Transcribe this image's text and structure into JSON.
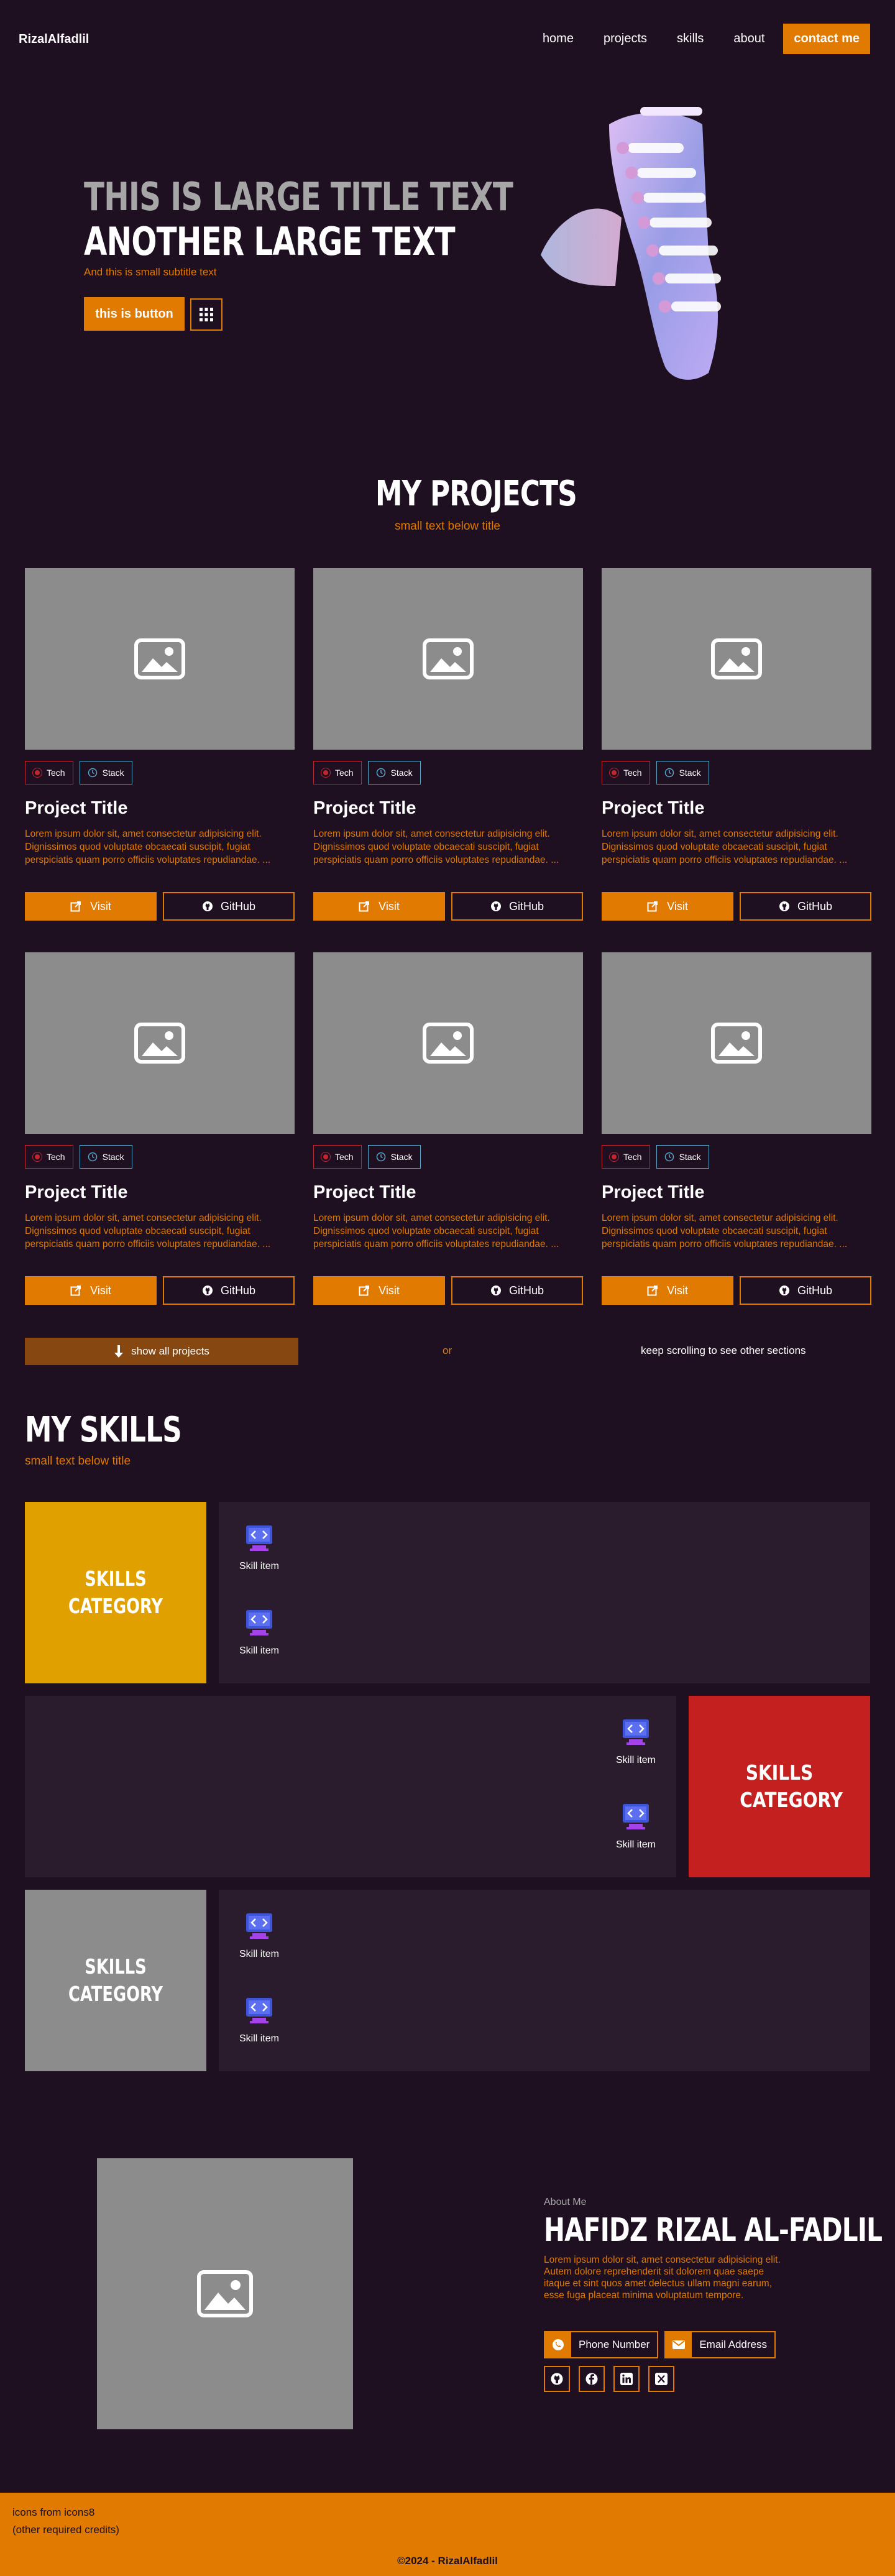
{
  "nav": {
    "brand": "RizalAlfadlil",
    "links": [
      "home",
      "projects",
      "skills",
      "about"
    ],
    "cta": "contact me"
  },
  "hero": {
    "title_1": "THIS IS LARGE TITLE TEXT",
    "title_2": "ANOTHER LARGE TEXT",
    "subtitle": "And this is small subtitle text",
    "button": "this is button"
  },
  "projects": {
    "title": "MY PROJECTS",
    "subtitle": "small text below title",
    "cards": [
      {
        "tag_tech": "Tech",
        "tag_stack": "Stack",
        "title": "Project Title",
        "desc": "Lorem ipsum dolor sit, amet consectetur adipisicing elit. Dignissimos quod voluptate obcaecati suscipit, fugiat perspiciatis quam porro officiis voluptates repudiandae. ...",
        "visit": "Visit",
        "github": "GitHub"
      },
      {
        "tag_tech": "Tech",
        "tag_stack": "Stack",
        "title": "Project Title",
        "desc": "Lorem ipsum dolor sit, amet consectetur adipisicing elit. Dignissimos quod voluptate obcaecati suscipit, fugiat perspiciatis quam porro officiis voluptates repudiandae. ...",
        "visit": "Visit",
        "github": "GitHub"
      },
      {
        "tag_tech": "Tech",
        "tag_stack": "Stack",
        "title": "Project Title",
        "desc": "Lorem ipsum dolor sit, amet consectetur adipisicing elit. Dignissimos quod voluptate obcaecati suscipit, fugiat perspiciatis quam porro officiis voluptates repudiandae. ...",
        "visit": "Visit",
        "github": "GitHub"
      },
      {
        "tag_tech": "Tech",
        "tag_stack": "Stack",
        "title": "Project Title",
        "desc": "Lorem ipsum dolor sit, amet consectetur adipisicing elit. Dignissimos quod voluptate obcaecati suscipit, fugiat perspiciatis quam porro officiis voluptates repudiandae. ...",
        "visit": "Visit",
        "github": "GitHub"
      },
      {
        "tag_tech": "Tech",
        "tag_stack": "Stack",
        "title": "Project Title",
        "desc": "Lorem ipsum dolor sit, amet consectetur adipisicing elit. Dignissimos quod voluptate obcaecati suscipit, fugiat perspiciatis quam porro officiis voluptates repudiandae. ...",
        "visit": "Visit",
        "github": "GitHub"
      },
      {
        "tag_tech": "Tech",
        "tag_stack": "Stack",
        "title": "Project Title",
        "desc": "Lorem ipsum dolor sit, amet consectetur adipisicing elit. Dignissimos quod voluptate obcaecati suscipit, fugiat perspiciatis quam porro officiis voluptates repudiandae. ...",
        "visit": "Visit",
        "github": "GitHub"
      }
    ],
    "show_all": "show all projects",
    "or": "or",
    "keep_scrolling": "keep scrolling to see other sections"
  },
  "skills": {
    "title": "MY SKILLS",
    "subtitle": "small text below title",
    "categories": [
      {
        "name": "SKILLS CATEGORY",
        "color": "#e0a000",
        "items": [
          "Skill item",
          "Skill item"
        ]
      },
      {
        "name": "SKILLS CATEGORY",
        "color": "#c4201f",
        "items": [
          "Skill item",
          "Skill item"
        ]
      },
      {
        "name": "SKILLS CATEGORY",
        "color": "#8c8c8c",
        "items": [
          "Skill item",
          "Skill item"
        ]
      }
    ]
  },
  "about": {
    "kicker": "About Me",
    "name": "HAFIDZ RIZAL AL-FADLIL",
    "desc": "Lorem ipsum dolor sit, amet consectetur adipisicing elit. Autem dolore reprehenderit sit dolorem quae saepe itaque et sint quos amet delectus ullam magni earum, esse fuga placeat minima voluptatum tempore.",
    "phone": "Phone Number",
    "email": "Email Address",
    "socials": [
      "github-icon",
      "facebook-icon",
      "linkedin-icon",
      "x-icon"
    ]
  },
  "footer": {
    "credit_1": "icons from icons8",
    "credit_2": "(other required credits)",
    "copyright": "©2024 - RizalAlfadlil"
  },
  "colors": {
    "bg": "#1e0f21",
    "accent": "#e07a00",
    "panel": "#2a1c2d",
    "placeholder": "#8c8c8c"
  }
}
